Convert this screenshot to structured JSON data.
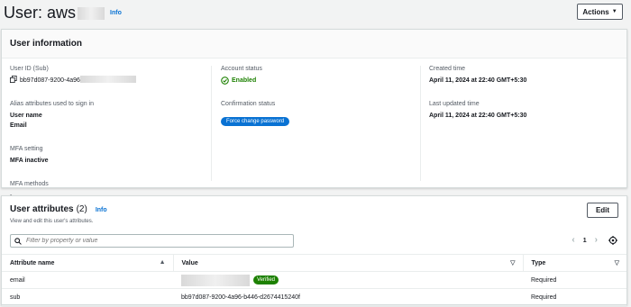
{
  "header": {
    "title": "User: aws",
    "info_label": "Info",
    "actions_label": "Actions"
  },
  "user_information": {
    "title": "User information",
    "col1": {
      "user_id_label": "User ID (Sub)",
      "user_id_value": "bb97d087-9200-4a96",
      "alias_label": "Alias attributes used to sign in",
      "alias_values": [
        "User name",
        "Email"
      ],
      "mfa_setting_label": "MFA setting",
      "mfa_setting_value": "MFA inactive",
      "mfa_methods_label": "MFA methods",
      "mfa_methods_value": "-"
    },
    "col2": {
      "account_status_label": "Account status",
      "account_status_value": "Enabled",
      "confirmation_label": "Confirmation status",
      "confirmation_value": "Force change password"
    },
    "col3": {
      "created_label": "Created time",
      "created_value": "April 11, 2024 at 22:40 GMT+5:30",
      "updated_label": "Last updated time",
      "updated_value": "April 11, 2024 at 22:40 GMT+5:30"
    }
  },
  "user_attributes": {
    "title": "User attributes",
    "count": "(2)",
    "info_label": "Info",
    "description": "View and edit this user's attributes.",
    "edit_label": "Edit",
    "search_placeholder": "Filter by property or value",
    "page_number": "1",
    "columns": [
      "Attribute name",
      "Value",
      "Type"
    ],
    "rows": [
      {
        "name": "email",
        "value": "",
        "badge": "Verified",
        "type": "Required"
      },
      {
        "name": "sub",
        "value": "bb97d087-9200-4a96-b446-d2674415240f",
        "badge": "",
        "type": "Required"
      }
    ]
  },
  "colors": {
    "link": "#0972d3",
    "success": "#1d8102",
    "badge_blue": "#0972d3"
  },
  "icons": [
    "copy-icon",
    "check-circle-icon",
    "search-icon",
    "chevron-left-icon",
    "chevron-right-icon",
    "settings-icon",
    "caret-down-icon",
    "sort-asc-icon",
    "sort-icon"
  ]
}
